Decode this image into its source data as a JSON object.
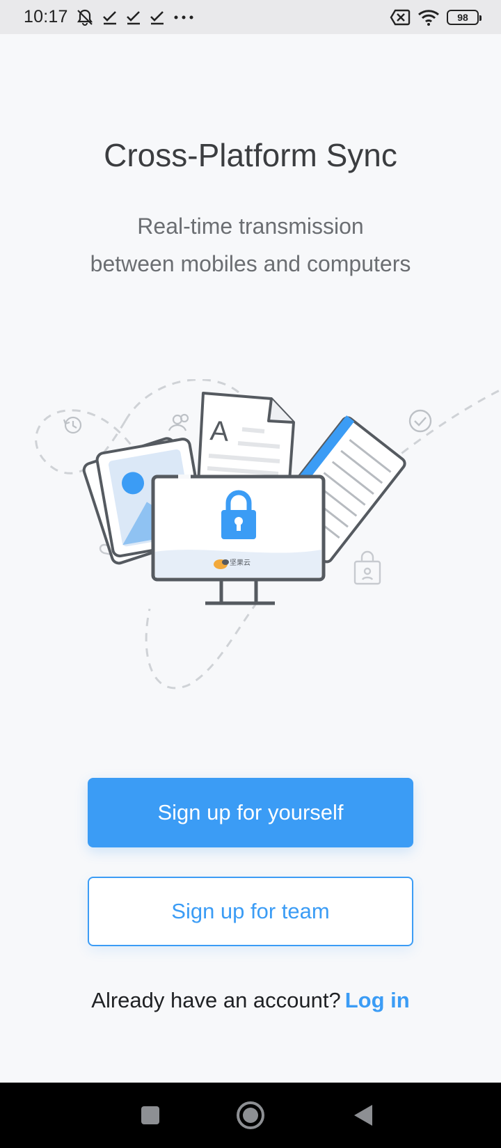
{
  "status_bar": {
    "time": "10:17",
    "left_icons": [
      "mute-notifications-icon",
      "check-icon",
      "check-icon",
      "check-icon",
      "more-dots-icon"
    ],
    "right_icons": [
      "no-sim-icon",
      "wifi-icon"
    ],
    "battery": "98"
  },
  "onboarding": {
    "title": "Cross-Platform Sync",
    "subtitle_line1": "Real-time transmission",
    "subtitle_line2": "between mobiles and computers",
    "illustration_brand": "坚果云"
  },
  "actions": {
    "signup_self_label": "Sign up for yourself",
    "signup_team_label": "Sign up for team",
    "login_prompt": "Already have an account?",
    "login_link": "Log in"
  },
  "nav_bar": {
    "icons": [
      "recents-square-icon",
      "home-circle-icon",
      "back-triangle-icon"
    ]
  },
  "colors": {
    "accent": "#3b9cf5",
    "background": "#f7f8fa",
    "status_bar": "#e9e9eb",
    "nav_bar": "#000000"
  }
}
